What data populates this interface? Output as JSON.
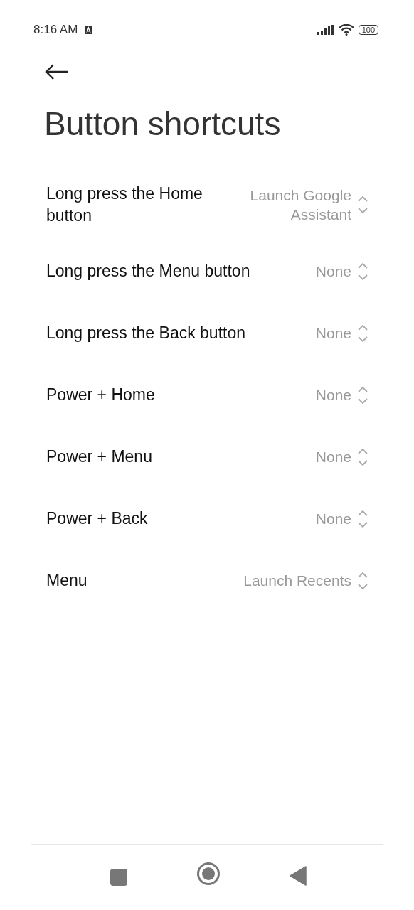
{
  "status_bar": {
    "time": "8:16 AM",
    "battery": "100"
  },
  "title": "Button shortcuts",
  "settings": [
    {
      "label": "Long press the Home button",
      "value": "Launch Google Assistant"
    },
    {
      "label": "Long press the Menu button",
      "value": "None"
    },
    {
      "label": "Long press the Back button",
      "value": "None"
    },
    {
      "label": "Power + Home",
      "value": "None"
    },
    {
      "label": "Power + Menu",
      "value": "None"
    },
    {
      "label": "Power + Back",
      "value": "None"
    },
    {
      "label": "Menu",
      "value": "Launch Recents"
    }
  ]
}
